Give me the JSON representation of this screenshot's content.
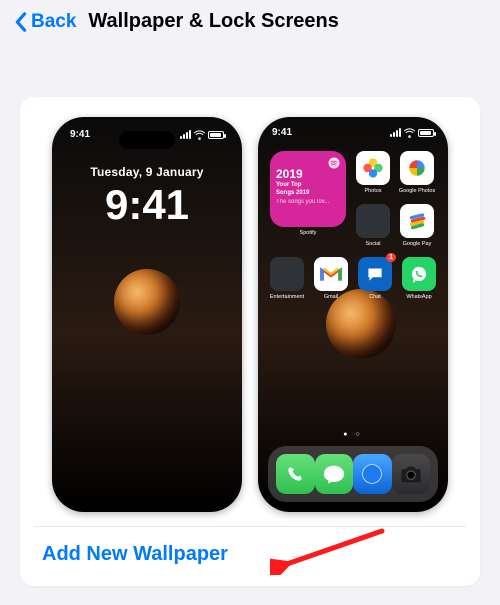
{
  "header": {
    "back_label": "Back",
    "title": "Wallpaper & Lock Screens"
  },
  "colors": {
    "accent": "#007aff",
    "widget_bg": "#d6269b"
  },
  "lock_preview": {
    "time_small": "9:41",
    "date": "Tuesday, 9 January",
    "time": "9:41"
  },
  "home_preview": {
    "time": "9:41",
    "widget": {
      "year": "2019",
      "line1": "Your Top",
      "line2": "Songs 2019",
      "line3": "The songs you lov...",
      "app_label": "Spotify"
    },
    "row1_right": [
      {
        "name": "Photos",
        "bg": "#ffffff"
      },
      {
        "name": "Google Photos",
        "bg": "#ffffff"
      },
      {
        "name": "Social",
        "bg": "#2f3338"
      },
      {
        "name": "Google Pay",
        "bg": "#ffffff"
      }
    ],
    "row2": [
      {
        "name": "Entertainment",
        "bg": "#2f3338"
      },
      {
        "name": "Gmail",
        "bg": "#ffffff"
      },
      {
        "name": "Chat",
        "bg": "#0b65c3"
      },
      {
        "name": "WhatsApp",
        "bg": "#25d366"
      }
    ],
    "dock": [
      {
        "name": "Phone",
        "bg": "#30d158"
      },
      {
        "name": "Messages",
        "bg": "#30d158"
      },
      {
        "name": "Safari",
        "bg": "#1e7af0"
      },
      {
        "name": "Camera",
        "bg": "#3a3a3c"
      }
    ]
  },
  "actions": {
    "add_label": "Add New Wallpaper"
  }
}
